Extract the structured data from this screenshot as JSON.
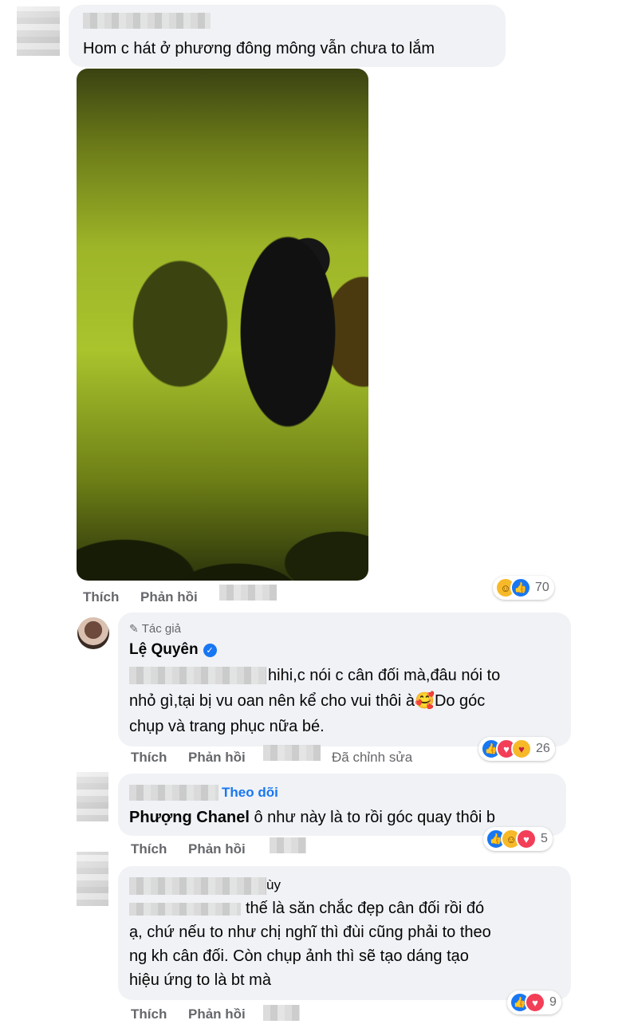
{
  "comments": [
    {
      "text": "Hom c hát ở phương đông mông vẫn chưa to lắm",
      "actions": {
        "like": "Thích",
        "reply": "Phản hồi"
      },
      "reactions": {
        "icons": [
          "haha-icon",
          "like-icon"
        ],
        "count": "70"
      }
    },
    {
      "author_badge": "Tác giả",
      "author": "Lệ Quyên",
      "verified": true,
      "lines": [
        "hihi,c nói c cân đối mà,đâu nói to",
        "nhỏ gì,tại bị vu oan nên kể cho vui thôi à",
        "chụp và trang phục nữa bé."
      ],
      "line2_suffix": "Do góc",
      "emoji": "🥰",
      "actions": {
        "like": "Thích",
        "reply": "Phản hồi",
        "edited": "Đã chỉnh sửa"
      },
      "reactions": {
        "icons": [
          "like-icon",
          "love-icon",
          "care-icon"
        ],
        "count": "26"
      }
    },
    {
      "follow": "Theo dõi",
      "mention": "Phượng Chanel",
      "text": "ô như này là to rồi góc quay thôi b",
      "actions": {
        "like": "Thích",
        "reply": "Phản hồi"
      },
      "reactions": {
        "icons": [
          "like-icon",
          "haha-icon",
          "love-icon"
        ],
        "count": "5"
      }
    },
    {
      "name_tail": "ùy",
      "lines": [
        "thế là săn chắc đẹp cân đối rồi đó",
        "ạ, chứ nếu to như chị nghĩ thì đùi cũng phải to theo",
        "ng kh cân đối. Còn chụp ảnh thì sẽ tạo dáng tạo",
        "hiệu ứng to là bt mà"
      ],
      "mention_partial": "Phượng Chanel",
      "actions": {
        "like": "Thích",
        "reply": "Phản hồi"
      },
      "reactions": {
        "icons": [
          "like-icon",
          "love-icon"
        ],
        "count": "9"
      }
    }
  ],
  "colors": {
    "bubble": "#f0f2f5",
    "meta": "#65676b",
    "link": "#1877f2",
    "like": "#1877f2",
    "love": "#f33e58",
    "haha": "#f7b928"
  }
}
